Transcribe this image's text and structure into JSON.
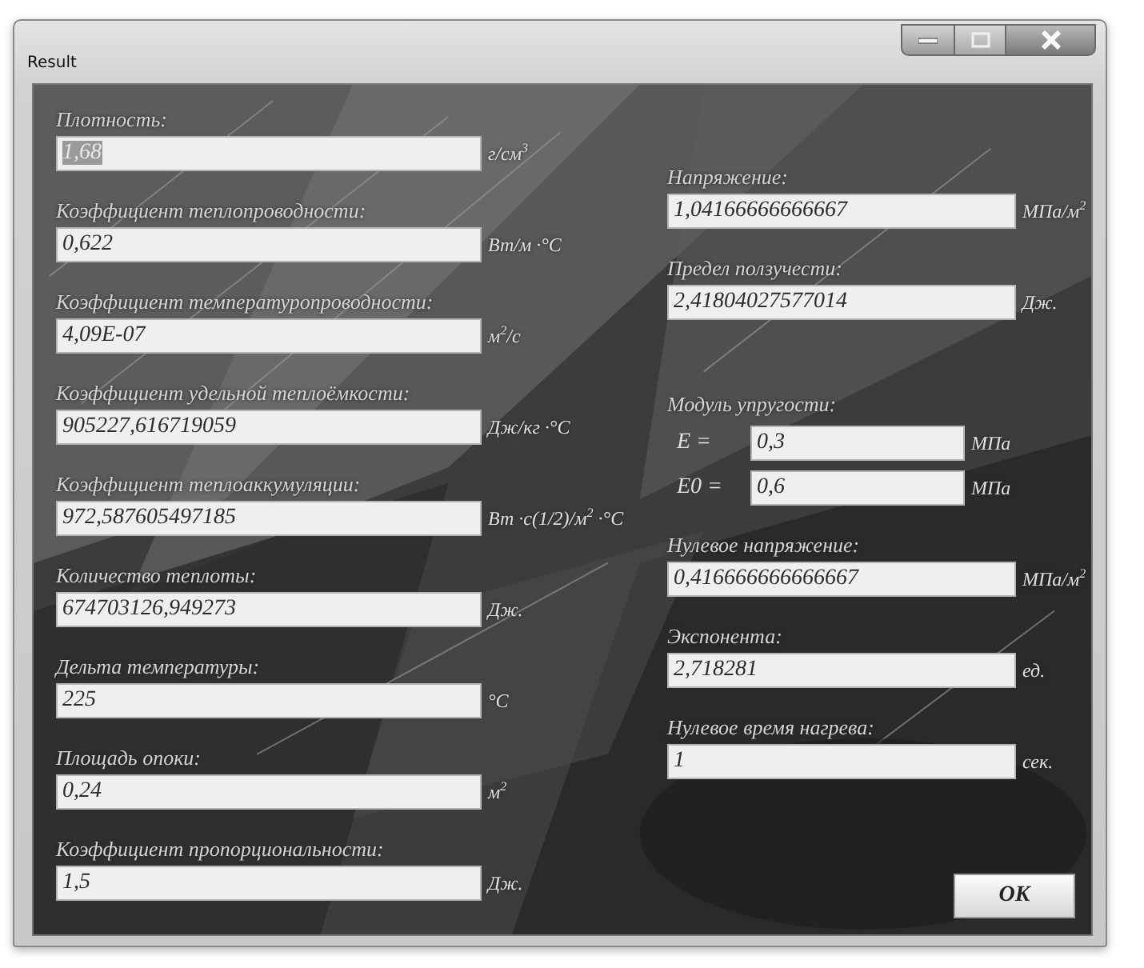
{
  "window": {
    "title": "Result",
    "controls": [
      {
        "kind": "minimize"
      },
      {
        "kind": "maximize"
      },
      {
        "kind": "close"
      }
    ]
  },
  "left": [
    {
      "label": "Плотность:",
      "value": "1,68",
      "unit": "г/см$^{3}$",
      "text_selected": true
    },
    {
      "label": "Коэффициент теплопроводности:",
      "value": "0,622",
      "unit": "Вт/м ·°С",
      "text_selected": false
    },
    {
      "label": "Коэффициент температуропроводности:",
      "value": "4,09E-07",
      "unit": "м$^{2}$/с",
      "text_selected": false
    },
    {
      "label": "Коэффициент удельной теплоёмкости:",
      "value": "905227,616719059",
      "unit": "Дж/кг ·°С",
      "text_selected": false
    },
    {
      "label": "Коэффициент теплоаккумуляции:",
      "value": "972,587605497185",
      "unit": "Вт ·с(1/2)/м$^{2}$ ·°С",
      "text_selected": false
    },
    {
      "label": "Количество теплоты:",
      "value": "674703126,949273",
      "unit": "Дж.",
      "text_selected": false
    },
    {
      "label": "Дельта температуры:",
      "value": "225",
      "unit": "°С",
      "text_selected": false
    },
    {
      "label": "Площадь опоки:",
      "value": "0,24",
      "unit": "м$^{2}$",
      "text_selected": false
    },
    {
      "label": "Коэффициент пропорциональности:",
      "value": "1,5",
      "unit": "Дж.",
      "text_selected": false
    }
  ],
  "right": [
    {
      "kind": "field",
      "label": "Напряжение:",
      "value": "1,04166666666667",
      "unit": "МПа/м$^{2}$"
    },
    {
      "kind": "field",
      "label": "Предел ползучести:",
      "value": "2,41804027577014",
      "unit": "Дж."
    },
    {
      "kind": "group",
      "label": "Модуль упругости:",
      "rows": [
        {
          "symbol": "E =",
          "value": "0,3",
          "unit": "МПа"
        },
        {
          "symbol": "E0 =",
          "value": "0,6",
          "unit": "МПа"
        }
      ]
    },
    {
      "kind": "field",
      "label": "Нулевое напряжение:",
      "value": "0,416666666666667",
      "unit": "МПа/м$^{2}$"
    },
    {
      "kind": "field",
      "label": "Экспонента:",
      "value": "2,718281",
      "unit": "ед."
    },
    {
      "kind": "field",
      "label": "Нулевое время нагрева:",
      "value": "1",
      "unit": "сек."
    }
  ],
  "ok_button": "OK"
}
